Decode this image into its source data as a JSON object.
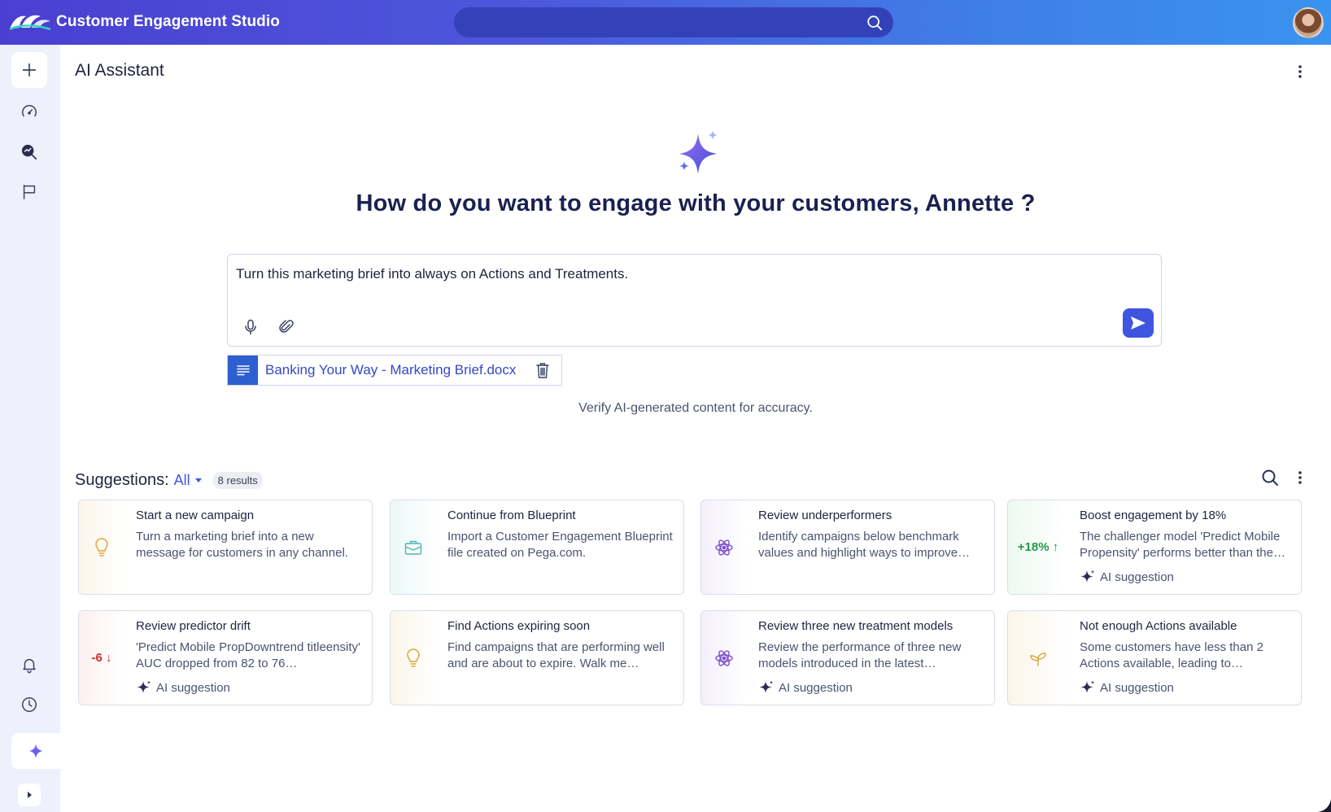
{
  "app": {
    "title": "Customer Engagement Studio"
  },
  "search": {
    "placeholder": ""
  },
  "page": {
    "title": "AI Assistant",
    "heading": "How do you want to engage with your customers, Annette ?"
  },
  "prompt": {
    "text": "Turn this marketing brief into always on Actions and Treatments."
  },
  "attachment": {
    "file_name": "Banking Your Way - Marketing Brief.docx"
  },
  "disclaimer": "Verify AI-generated content for accuracy.",
  "suggestions": {
    "label": "Suggestions:",
    "filter": "All",
    "count": "8 results",
    "ai_tag": "AI suggestion",
    "cards": [
      {
        "title": "Start a new campaign",
        "desc": "Turn a marketing brief into a new message for customers in any channel.",
        "icon": "lightbulb-icon",
        "tint": "#fbf6ea"
      },
      {
        "title": "Continue from Blueprint",
        "desc": "Import a Customer Engagement Blueprint file created on Pega.com.",
        "icon": "briefcase-icon",
        "tint": "#ecf8f8"
      },
      {
        "title": "Review underperformers",
        "desc": "Identify campaigns below benchmark values and highlight ways to improve…",
        "icon": "atom-icon",
        "tint": "#f3effb"
      },
      {
        "title": "Boost engagement by 18%",
        "desc": "The challenger model 'Predict Mobile Propensity' performs better than the…",
        "metric": "+18% ↑",
        "metric_color": "#1f9d4a",
        "tint": "#eef9f0"
      },
      {
        "title": "Review predictor drift",
        "desc": "'Predict Mobile PropDowntrend titleensity' AUC dropped from 82 to 76…",
        "metric": "-6 ↓",
        "metric_color": "#d12b2b",
        "tint": "#fdf0f0"
      },
      {
        "title": "Find Actions expiring soon",
        "desc": "Find campaigns that are performing well and are about to expire. Walk me…",
        "icon": "lightbulb-icon",
        "tint": "#fbf6ea"
      },
      {
        "title": "Review three new treatment models",
        "desc": "Review the performance of three new models introduced in the latest…",
        "icon": "atom-icon",
        "tint": "#f3effb"
      },
      {
        "title": "Not enough Actions available",
        "desc": "Some customers have less than 2 Actions available, leading to…",
        "icon": "sprout-icon",
        "tint": "#fbf6ea"
      }
    ]
  },
  "colors": {
    "accent": "#3f55e0",
    "topbar_start": "#4a3fd1",
    "topbar_end": "#3a93ef"
  }
}
